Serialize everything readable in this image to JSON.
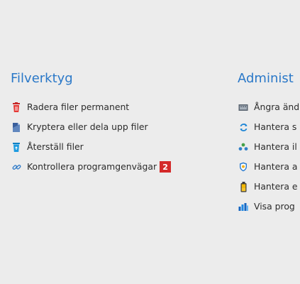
{
  "colors": {
    "background": "#ececec",
    "heading": "#2a78c8",
    "text": "#2b2b2b",
    "badge": "#d42a2a"
  },
  "files_section": {
    "title": "Filverktyg",
    "items": [
      {
        "label": "Radera filer permanent",
        "icon": "trash-icon"
      },
      {
        "label": "Kryptera eller dela upp filer",
        "icon": "encrypt-file-icon"
      },
      {
        "label": "Återställ filer",
        "icon": "recycle-bin-icon"
      },
      {
        "label": "Kontrollera programgenvägar",
        "icon": "broken-link-icon"
      }
    ],
    "badge": "2"
  },
  "admin_section": {
    "title": "Administ",
    "items": [
      {
        "label": "Ångra änd",
        "icon": "keyboard-icon"
      },
      {
        "label": "Hantera s",
        "icon": "refresh-icon"
      },
      {
        "label": "Hantera il",
        "icon": "group-icon"
      },
      {
        "label": "Hantera a",
        "icon": "shield-icon"
      },
      {
        "label": "Hantera e",
        "icon": "battery-icon"
      },
      {
        "label": "Visa prog",
        "icon": "bar-chart-icon"
      }
    ]
  }
}
